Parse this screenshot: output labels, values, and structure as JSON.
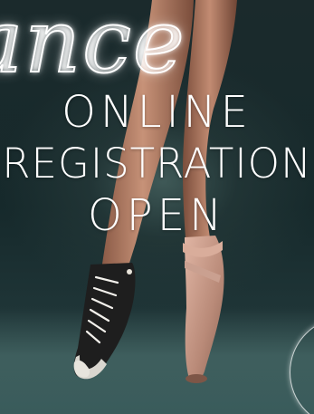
{
  "poster": {
    "script_word": "ance",
    "headline": {
      "line1": "ONLINE",
      "line2": "REGISTRATION",
      "line3": "OPEN"
    }
  },
  "colors": {
    "background": "#1b2a2c",
    "floor": "#5a7c7a",
    "skin": "#b6836c",
    "sneaker": "#1e1e1e",
    "pointe_shoe": "#c79a88",
    "text": "#ffffff"
  }
}
